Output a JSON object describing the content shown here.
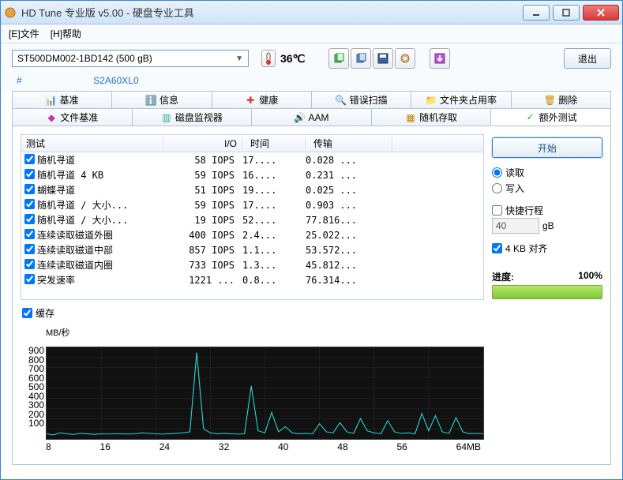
{
  "window": {
    "title": "HD Tune 专业版 v5.00 - 硬盘专业工具"
  },
  "menu": {
    "file": "[E]文件",
    "help": "[H]帮助"
  },
  "drive": {
    "text": "ST500DM002-1BD142      (500 gB)"
  },
  "temp": {
    "value": "36℃"
  },
  "serial": {
    "hash": "#",
    "value": "S2A60XL0"
  },
  "exit_label": "退出",
  "tabs_top": [
    {
      "label": "基准",
      "icon": "📊"
    },
    {
      "label": "信息",
      "icon": "ℹ️"
    },
    {
      "label": "健康",
      "icon": "✚",
      "color": "#d33"
    },
    {
      "label": "错误扫描",
      "icon": "🔍"
    },
    {
      "label": "文件夹占用率",
      "icon": "📁"
    },
    {
      "label": "删除",
      "icon": "🗑"
    }
  ],
  "tabs_bottom": [
    {
      "label": "文件基准",
      "icon": "◆",
      "color": "#c3a"
    },
    {
      "label": "磁盘监视器",
      "icon": "▥",
      "color": "#2a8"
    },
    {
      "label": "AAM",
      "icon": "🔊",
      "color": "#cc0"
    },
    {
      "label": "随机存取",
      "icon": "▦",
      "color": "#b80"
    },
    {
      "label": "额外测试",
      "icon": "✓",
      "color": "#2a2",
      "active": true
    }
  ],
  "table": {
    "headers": {
      "test": "测试",
      "io": "I/O",
      "time": "时间",
      "xfer": "传输"
    },
    "rows": [
      {
        "name": "随机寻道",
        "io": "58 IOPS",
        "time": "17....",
        "xfer": "0.028 ..."
      },
      {
        "name": "随机寻道 4 KB",
        "io": "59 IOPS",
        "time": "16....",
        "xfer": "0.231 ..."
      },
      {
        "name": "蝴蝶寻道",
        "io": "51 IOPS",
        "time": "19....",
        "xfer": "0.025 ..."
      },
      {
        "name": "随机寻道 / 大小...",
        "io": "59 IOPS",
        "time": "17....",
        "xfer": "0.903 ..."
      },
      {
        "name": "随机寻道 / 大小...",
        "io": "19 IOPS",
        "time": "52....",
        "xfer": "77.816..."
      },
      {
        "name": "连续读取磁道外圈",
        "io": "400 IOPS",
        "time": "2.4...",
        "xfer": "25.022..."
      },
      {
        "name": "连续读取磁道中部",
        "io": "857 IOPS",
        "time": "1.1...",
        "xfer": "53.572..."
      },
      {
        "name": "连续读取磁道内圈",
        "io": "733 IOPS",
        "time": "1.3...",
        "xfer": "45.812..."
      },
      {
        "name": "突发速率",
        "io": "1221 ...",
        "time": "0.8...",
        "xfer": "76.314..."
      }
    ]
  },
  "cache_label": "缓存",
  "right": {
    "start": "开始",
    "read": "读取",
    "write": "写入",
    "short_stroke": "快捷行程",
    "spin_value": "40",
    "spin_unit": "gB",
    "align": "4 KB 对齐",
    "progress_label": "进度:",
    "progress_value": "100%"
  },
  "chart_data": {
    "type": "line",
    "title": "",
    "ylabel": "MB/秒",
    "xlabel": "MB",
    "ylim": [
      0,
      900
    ],
    "xlim": [
      0,
      64
    ],
    "y_ticks": [
      100,
      200,
      300,
      400,
      500,
      600,
      700,
      800,
      900
    ],
    "x_ticks": [
      8,
      16,
      24,
      32,
      40,
      48,
      56,
      "64MB"
    ],
    "x": [
      0,
      1,
      2,
      3,
      4,
      5,
      6,
      7,
      8,
      9,
      10,
      11,
      12,
      13,
      14,
      15,
      16,
      17,
      18,
      19,
      20,
      21,
      22,
      23,
      24,
      25,
      26,
      27,
      28,
      29,
      30,
      31,
      32,
      33,
      34,
      35,
      36,
      37,
      38,
      39,
      40,
      41,
      42,
      43,
      44,
      45,
      46,
      47,
      48,
      49,
      50,
      51,
      52,
      53,
      54,
      55,
      56,
      57,
      58,
      59,
      60,
      61,
      62,
      63,
      64
    ],
    "y": [
      50,
      40,
      60,
      50,
      45,
      55,
      50,
      45,
      50,
      48,
      52,
      50,
      48,
      50,
      60,
      55,
      50,
      48,
      50,
      55,
      60,
      70,
      850,
      100,
      60,
      50,
      55,
      50,
      48,
      50,
      520,
      80,
      60,
      260,
      70,
      120,
      60,
      50,
      55,
      50,
      150,
      70,
      60,
      160,
      70,
      55,
      200,
      80,
      60,
      50,
      180,
      70,
      55,
      60,
      50,
      250,
      80,
      230,
      70,
      55,
      210,
      70,
      50,
      55,
      50
    ]
  }
}
